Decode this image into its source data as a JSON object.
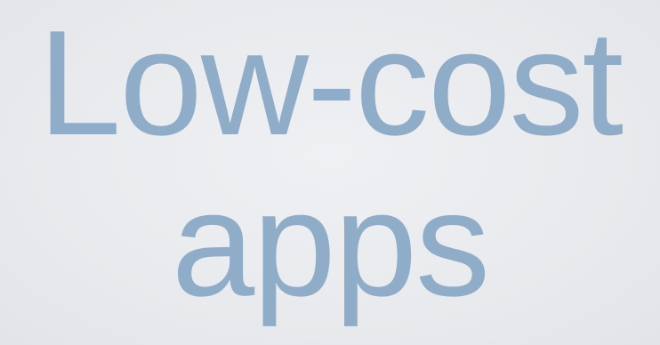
{
  "slide": {
    "title_line_1": "Low-cost",
    "title_line_2": "apps",
    "text_color": "#8fadc8",
    "background_color": "#e9ebee"
  }
}
